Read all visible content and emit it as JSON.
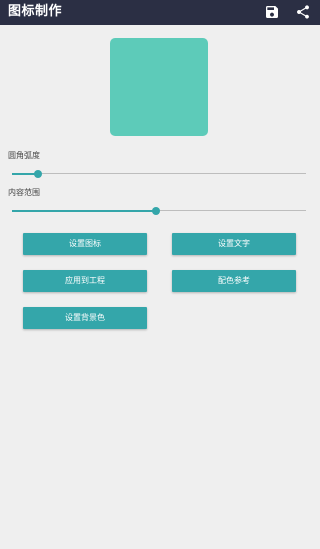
{
  "app": {
    "title": "图标制作",
    "actions": [
      {
        "icon": "save-icon"
      },
      {
        "icon": "share-icon"
      }
    ]
  },
  "colors": {
    "appbar": "#2b2f44",
    "accent": "#34a6aa",
    "preview": "#5dcbb9",
    "background": "#efefef"
  },
  "preview": {
    "label": ""
  },
  "sliders": {
    "corner_radius": {
      "label": "圆角弧度",
      "value": 0.09
    },
    "content_range": {
      "label": "内容范围",
      "value": 0.49
    }
  },
  "buttons": {
    "set_icon": "设置图标",
    "set_text": "设置文字",
    "apply_to_project": "应用到工程",
    "color_reference": "配色参考",
    "set_background": "设置背景色"
  }
}
